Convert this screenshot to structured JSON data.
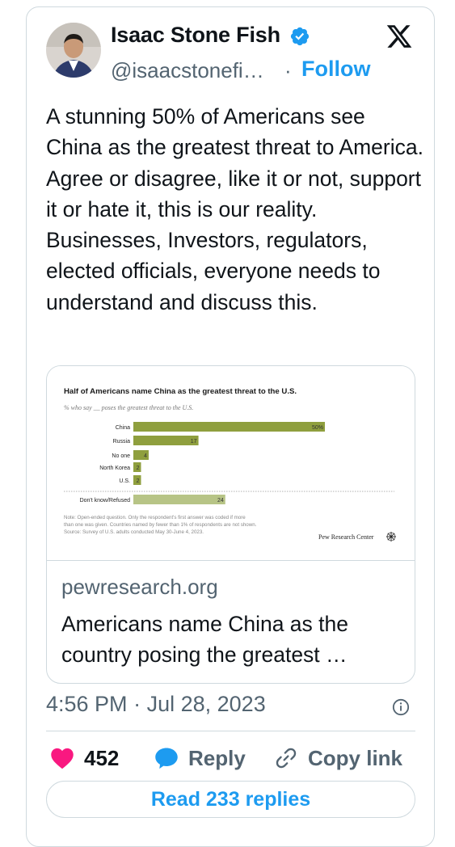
{
  "author": {
    "name": "Isaac Stone Fish",
    "handle": "@isaacstonefi…",
    "separator": "·",
    "follow_label": "Follow"
  },
  "tweet": {
    "text": "A stunning 50% of Americans see China as the greatest threat to America. Agree or disagree, like it or not, support it or hate it, this is our reality. Businesses, Investors, regulators, elected officials, everyone needs to understand and discuss this."
  },
  "link_card": {
    "domain": "pewresearch.org",
    "title": "Americans name China as the country posing the greatest …"
  },
  "chart_data": {
    "type": "bar",
    "title": "Half of Americans name China as the greatest threat to the U.S.",
    "subtitle": "% who say __ poses the greatest threat to the U.S.",
    "categories": [
      "China",
      "Russia",
      "No one",
      "North Korea",
      "U.S.",
      "Don't know/Refused"
    ],
    "values": [
      50,
      17,
      4,
      2,
      2,
      24
    ],
    "value_labels": [
      "50%",
      "17",
      "4",
      "2",
      "2",
      "24"
    ],
    "colors": {
      "main": "#8f9f3e",
      "dk": "#b7c486"
    },
    "note": [
      "Note: Open-ended question. Only the respondent's first answer was coded if more",
      "than one was given. Countries named by fewer than 1% of respondents are not shown.",
      "Source: Survey of U.S. adults conducted May 30-June 4, 2023."
    ],
    "source_label": "Pew Research Center"
  },
  "timestamp": {
    "time": "4:56 PM",
    "separator": "·",
    "date": "Jul 28, 2023"
  },
  "actions": {
    "likes": "452",
    "reply_label": "Reply",
    "copy_label": "Copy link"
  },
  "read_replies_label": "Read 233 replies",
  "colors": {
    "accent": "#1d9bf0",
    "like": "#f91880",
    "secondary_text": "#536471",
    "border": "#cfd9de"
  }
}
